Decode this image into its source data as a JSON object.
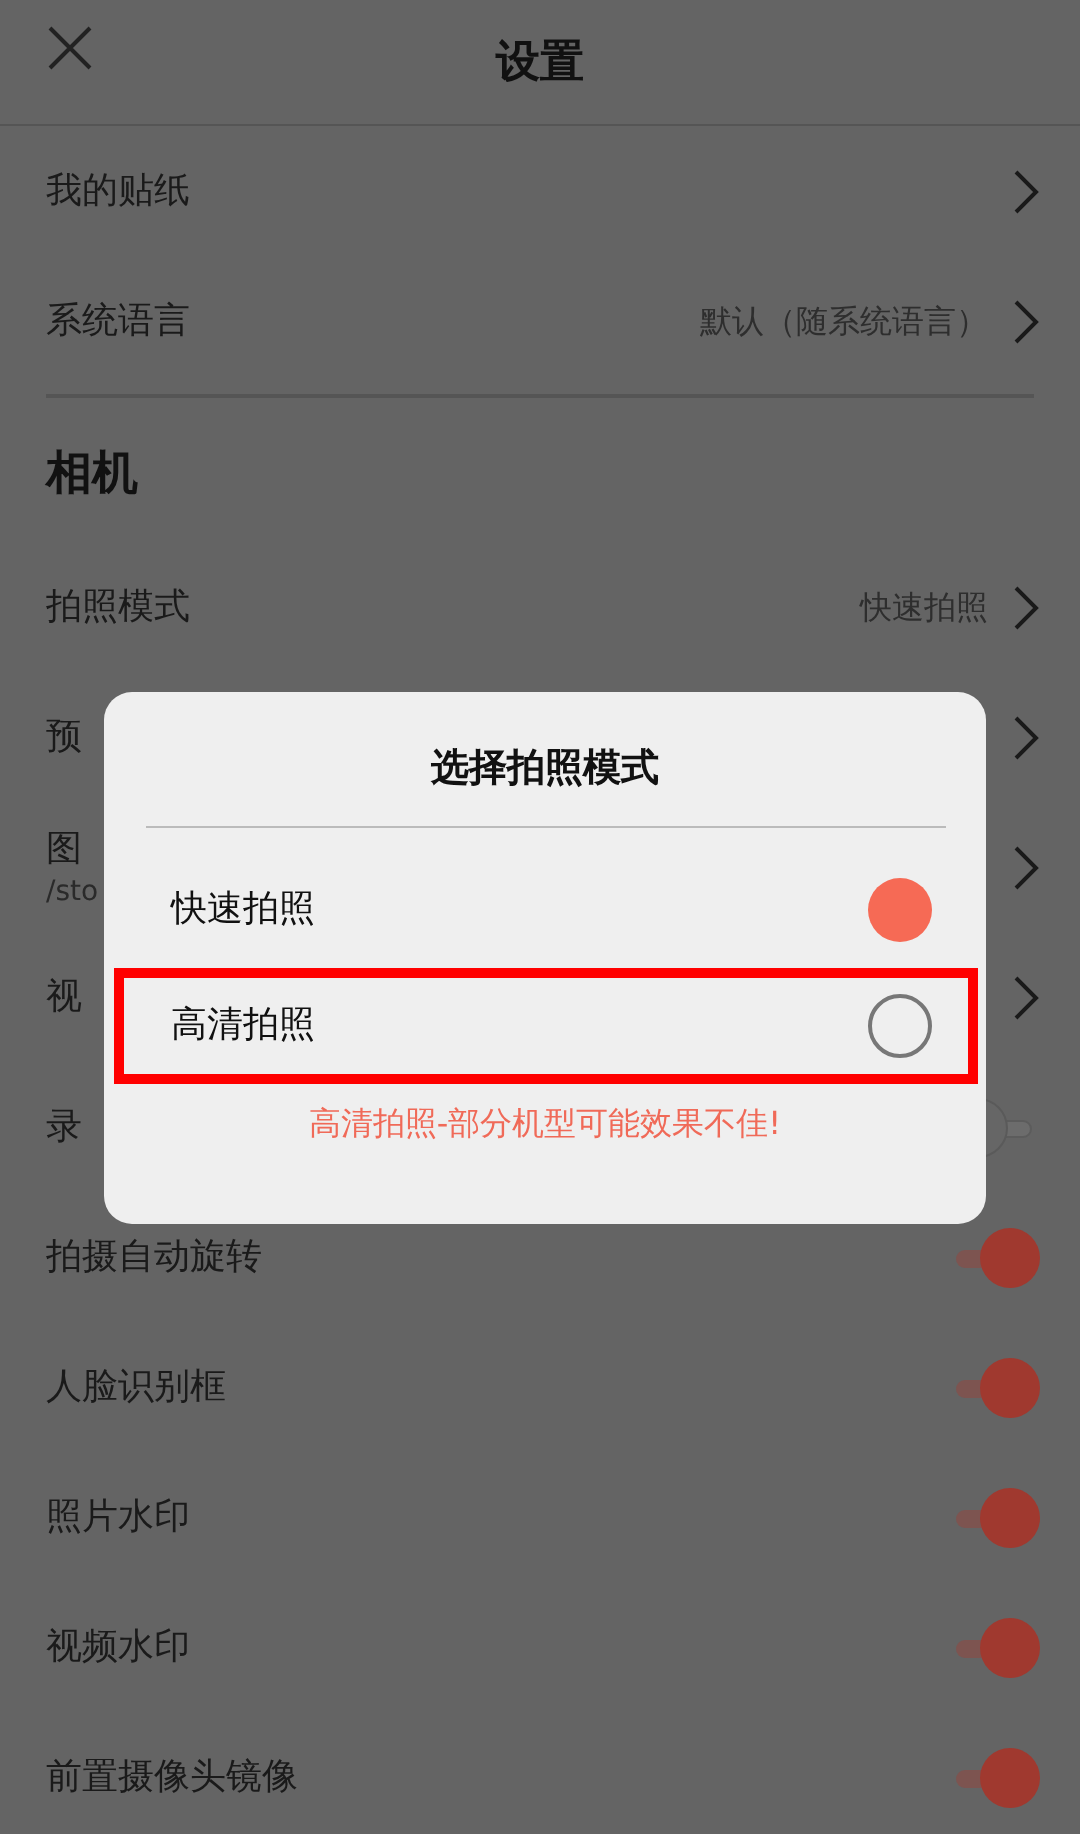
{
  "header": {
    "title": "设置"
  },
  "rows": [
    {
      "kind": "link",
      "label": "我的贴纸"
    },
    {
      "kind": "link",
      "label": "系统语言",
      "value": "默认（随系统语言）"
    },
    {
      "kind": "divider"
    },
    {
      "kind": "section",
      "label": "相机"
    },
    {
      "kind": "link",
      "label": "拍照模式",
      "value": "快速拍照"
    },
    {
      "kind": "link",
      "label": "预"
    },
    {
      "kind": "link",
      "label": "图",
      "subtitle": "/sto"
    },
    {
      "kind": "link",
      "label": "视"
    },
    {
      "kind": "toggle",
      "label": "录",
      "on": false
    },
    {
      "kind": "toggle",
      "label": "拍摄自动旋转",
      "on": true
    },
    {
      "kind": "toggle",
      "label": "人脸识别框",
      "on": true
    },
    {
      "kind": "toggle",
      "label": "照片水印",
      "on": true
    },
    {
      "kind": "toggle",
      "label": "视频水印",
      "on": true
    },
    {
      "kind": "toggle",
      "label": "前置摄像头镜像",
      "on": true
    }
  ],
  "dialog": {
    "title": "选择拍照模式",
    "options": [
      {
        "label": "快速拍照",
        "selected": true,
        "highlighted": false
      },
      {
        "label": "高清拍照",
        "selected": false,
        "highlighted": true
      }
    ],
    "note": "高清拍照-部分机型可能效果不佳!"
  }
}
